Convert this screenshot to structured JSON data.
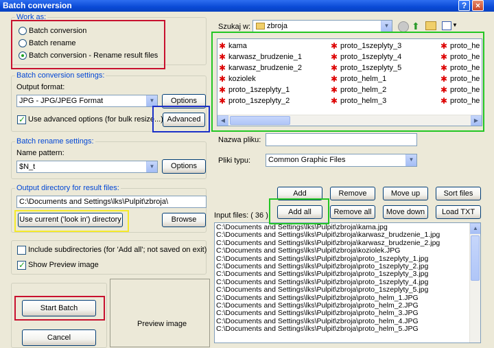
{
  "window": {
    "title": "Batch conversion",
    "help_glyph": "?",
    "close_glyph": "×"
  },
  "work_as": {
    "label": "Work as:",
    "options": [
      {
        "label": "Batch conversion",
        "selected": false
      },
      {
        "label": "Batch rename",
        "selected": false
      },
      {
        "label": "Batch conversion - Rename result files",
        "selected": true
      }
    ]
  },
  "conversion_settings": {
    "label": "Batch conversion settings:",
    "output_format_label": "Output format:",
    "output_format_value": "JPG - JPG/JPEG Format",
    "options_button": "Options",
    "advanced_checkbox_label": "Use advanced options (for bulk resize...)",
    "advanced_checked": true,
    "advanced_button": "Advanced"
  },
  "rename_settings": {
    "label": "Batch rename settings:",
    "name_pattern_label": "Name pattern:",
    "name_pattern_value": "$N_t",
    "options_button": "Options"
  },
  "output_dir": {
    "label": "Output directory for result files:",
    "path": "C:\\Documents and Settings\\lks\\Pulpit\\zbroja\\",
    "use_current_button": "Use current ('look in') directory",
    "browse_button": "Browse"
  },
  "include_subdirs": {
    "label": "Include subdirectories (for 'Add all'; not saved on exit)",
    "checked": false
  },
  "show_preview": {
    "label": "Show Preview image",
    "checked": true
  },
  "start_batch_button": "Start Batch",
  "cancel_button": "Cancel",
  "preview_label": "Preview image",
  "browser": {
    "look_in_label": "Szukaj w:",
    "look_in_value": "zbroja",
    "file_columns": [
      [
        "kama",
        "karwasz_brudzenie_1",
        "karwasz_brudzenie_2",
        "koziolek",
        "proto_1szeplyty_1",
        "proto_1szeplyty_2"
      ],
      [
        "proto_1szeplyty_3",
        "proto_1szeplyty_4",
        "proto_1szeplyty_5",
        "proto_helm_1",
        "proto_helm_2",
        "proto_helm_3"
      ],
      [
        "proto_he",
        "proto_he",
        "proto_he",
        "proto_he",
        "proto_he",
        "proto_he"
      ]
    ],
    "filename_label": "Nazwa pliku:",
    "filename_value": "",
    "filetype_label": "Pliki typu:",
    "filetype_value": "Common Graphic Files"
  },
  "list_buttons": {
    "add": "Add",
    "remove": "Remove",
    "move_up": "Move up",
    "sort_files": "Sort files",
    "add_all": "Add all",
    "remove_all": "Remove all",
    "move_down": "Move down",
    "load_txt": "Load TXT"
  },
  "input_files": {
    "label": "Input files: ( 36 )",
    "items": [
      "C:\\Documents and Settings\\lks\\Pulpit\\zbroja\\kama.jpg",
      "C:\\Documents and Settings\\lks\\Pulpit\\zbroja\\karwasz_brudzenie_1.jpg",
      "C:\\Documents and Settings\\lks\\Pulpit\\zbroja\\karwasz_brudzenie_2.jpg",
      "C:\\Documents and Settings\\lks\\Pulpit\\zbroja\\koziolek.JPG",
      "C:\\Documents and Settings\\lks\\Pulpit\\zbroja\\proto_1szeplyty_1.jpg",
      "C:\\Documents and Settings\\lks\\Pulpit\\zbroja\\proto_1szeplyty_2.jpg",
      "C:\\Documents and Settings\\lks\\Pulpit\\zbroja\\proto_1szeplyty_3.jpg",
      "C:\\Documents and Settings\\lks\\Pulpit\\zbroja\\proto_1szeplyty_4.jpg",
      "C:\\Documents and Settings\\lks\\Pulpit\\zbroja\\proto_1szeplyty_5.jpg",
      "C:\\Documents and Settings\\lks\\Pulpit\\zbroja\\proto_helm_1.JPG",
      "C:\\Documents and Settings\\lks\\Pulpit\\zbroja\\proto_helm_2.JPG",
      "C:\\Documents and Settings\\lks\\Pulpit\\zbroja\\proto_helm_3.JPG",
      "C:\\Documents and Settings\\lks\\Pulpit\\zbroja\\proto_helm_4.JPG",
      "C:\\Documents and Settings\\lks\\Pulpit\\zbroja\\proto_helm_5.JPG"
    ]
  },
  "highlight_colors": {
    "red": "#c8102e",
    "blue": "#1a2fc8",
    "green": "#22c622",
    "yellow": "#f5ea2a"
  }
}
